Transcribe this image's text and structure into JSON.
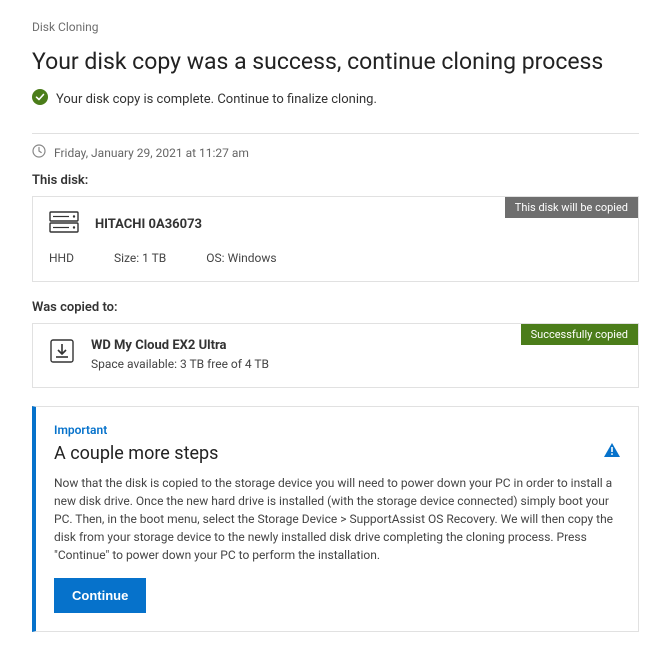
{
  "breadcrumb": "Disk Cloning",
  "title": "Your disk copy was a success, continue cloning process",
  "status": {
    "text": "Your disk copy is complete. Continue to finalize cloning."
  },
  "timestamp": "Friday, January 29, 2021 at 11:27 am",
  "source": {
    "section_label": "This disk:",
    "tag": "This disk will be copied",
    "name": "HITACHI 0A36073",
    "meta": {
      "type_label": "HHD",
      "size_label": "Size:",
      "size_value": "1 TB",
      "os_label": "OS:",
      "os_value": "Windows"
    }
  },
  "dest": {
    "section_label": "Was copied to:",
    "tag": "Successfully copied",
    "name": "WD My Cloud EX2 Ultra",
    "space_label": "Space available:",
    "space_value": "3 TB free of 4 TB"
  },
  "important": {
    "label": "Important",
    "title": "A couple more steps",
    "body": "Now that the disk is copied to the storage device you will need to power down your PC in order to install a new disk drive. Once the new hard drive is installed (with the storage device connected) simply boot your PC. Then, in the boot menu, select the Storage Device > SupportAssist OS Recovery. We will then copy the disk from your storage device to the newly installed disk drive completing the cloning process. Press \"Continue\" to power down your PC to perform the installation.",
    "button": "Continue"
  }
}
